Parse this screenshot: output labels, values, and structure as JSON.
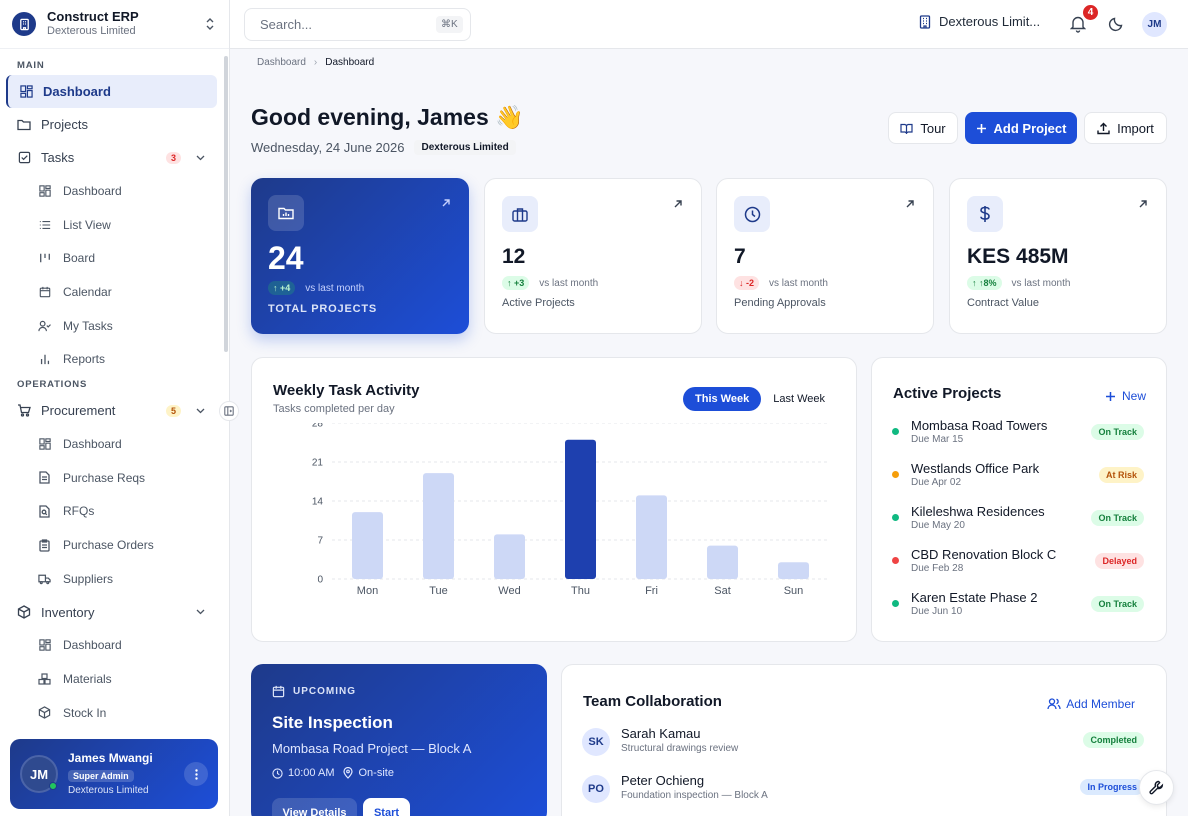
{
  "app": {
    "name": "Construct ERP",
    "company": "Dexterous Limited"
  },
  "sidebar": {
    "section_main": "MAIN",
    "section_operations": "OPERATIONS",
    "dashboard": "Dashboard",
    "projects": "Projects",
    "tasks": {
      "label": "Tasks",
      "badge": "3",
      "items": [
        "Dashboard",
        "List View",
        "Board",
        "Calendar",
        "My Tasks",
        "Reports"
      ]
    },
    "procurement": {
      "label": "Procurement",
      "badge": "5",
      "items": [
        "Dashboard",
        "Purchase Reqs",
        "RFQs",
        "Purchase Orders",
        "Suppliers"
      ]
    },
    "inventory": {
      "label": "Inventory",
      "items": [
        "Dashboard",
        "Materials",
        "Stock In"
      ]
    }
  },
  "user": {
    "initials": "JM",
    "name": "James Mwangi",
    "role": "Super Admin",
    "company": "Dexterous Limited"
  },
  "topbar": {
    "search_placeholder": "Search...",
    "shortcut": "⌘K",
    "company": "Dexterous Limit...",
    "notifications": "4",
    "avatar": "JM"
  },
  "breadcrumb": [
    "Dashboard",
    "Dashboard"
  ],
  "header": {
    "greeting": "Good evening, James 👋",
    "date": "Wednesday, 24 June 2026",
    "company_tag": "Dexterous Limited",
    "tour": "Tour",
    "add_project": "Add Project",
    "import": "Import"
  },
  "stats": [
    {
      "value": "24",
      "delta": "+4",
      "delta_dir": "up",
      "vs": "vs last month",
      "label": "TOTAL PROJECTS",
      "icon": "projects-icon"
    },
    {
      "value": "12",
      "delta": "+3",
      "delta_dir": "up",
      "vs": "vs last month",
      "label": "Active Projects",
      "icon": "briefcase-icon"
    },
    {
      "value": "7",
      "delta": "-2",
      "delta_dir": "down",
      "vs": "vs last month",
      "label": "Pending Approvals",
      "icon": "clock-icon"
    },
    {
      "value": "KES 485M",
      "delta": "8%",
      "delta_dir": "up",
      "vs": "vs last month",
      "label": "Contract Value",
      "icon": "dollar-icon"
    }
  ],
  "weekly": {
    "title": "Weekly Task Activity",
    "subtitle": "Tasks completed per day",
    "this_week": "This Week",
    "last_week": "Last Week"
  },
  "chart_data": {
    "type": "bar",
    "categories": [
      "Mon",
      "Tue",
      "Wed",
      "Thu",
      "Fri",
      "Sat",
      "Sun"
    ],
    "values": [
      12,
      19,
      8,
      25,
      15,
      6,
      3
    ],
    "highlight": "Thu",
    "yticks": [
      0,
      7,
      14,
      21,
      28
    ],
    "ylim": [
      0,
      28
    ],
    "grid": true,
    "colors": {
      "bar": "#cdd8f6",
      "highlight": "#1e40af"
    }
  },
  "active_projects": {
    "title": "Active Projects",
    "new_label": "New",
    "items": [
      {
        "name": "Mombasa Road Towers",
        "due": "Due Mar 15",
        "status": "On Track",
        "color": "#10b981",
        "tone": "green"
      },
      {
        "name": "Westlands Office Park",
        "due": "Due Apr 02",
        "status": "At Risk",
        "color": "#f59e0b",
        "tone": "amber"
      },
      {
        "name": "Kileleshwa Residences",
        "due": "Due May 20",
        "status": "On Track",
        "color": "#10b981",
        "tone": "green"
      },
      {
        "name": "CBD Renovation Block C",
        "due": "Due Feb 28",
        "status": "Delayed",
        "color": "#ef4444",
        "tone": "red"
      },
      {
        "name": "Karen Estate Phase 2",
        "due": "Due Jun 10",
        "status": "On Track",
        "color": "#10b981",
        "tone": "green"
      }
    ]
  },
  "upcoming": {
    "tag": "UPCOMING",
    "title": "Site Inspection",
    "subtitle": "Mombasa Road Project — Block A",
    "time": "10:00 AM",
    "location": "On-site",
    "view": "View Details",
    "start": "Start"
  },
  "team": {
    "title": "Team Collaboration",
    "add_member": "Add Member",
    "members": [
      {
        "initials": "SK",
        "name": "Sarah Kamau",
        "note": "Structural drawings review",
        "status": "Completed",
        "tone": "green"
      },
      {
        "initials": "PO",
        "name": "Peter Ochieng",
        "note": "Foundation inspection — Block A",
        "status": "In Progress",
        "tone": "blue"
      }
    ]
  }
}
